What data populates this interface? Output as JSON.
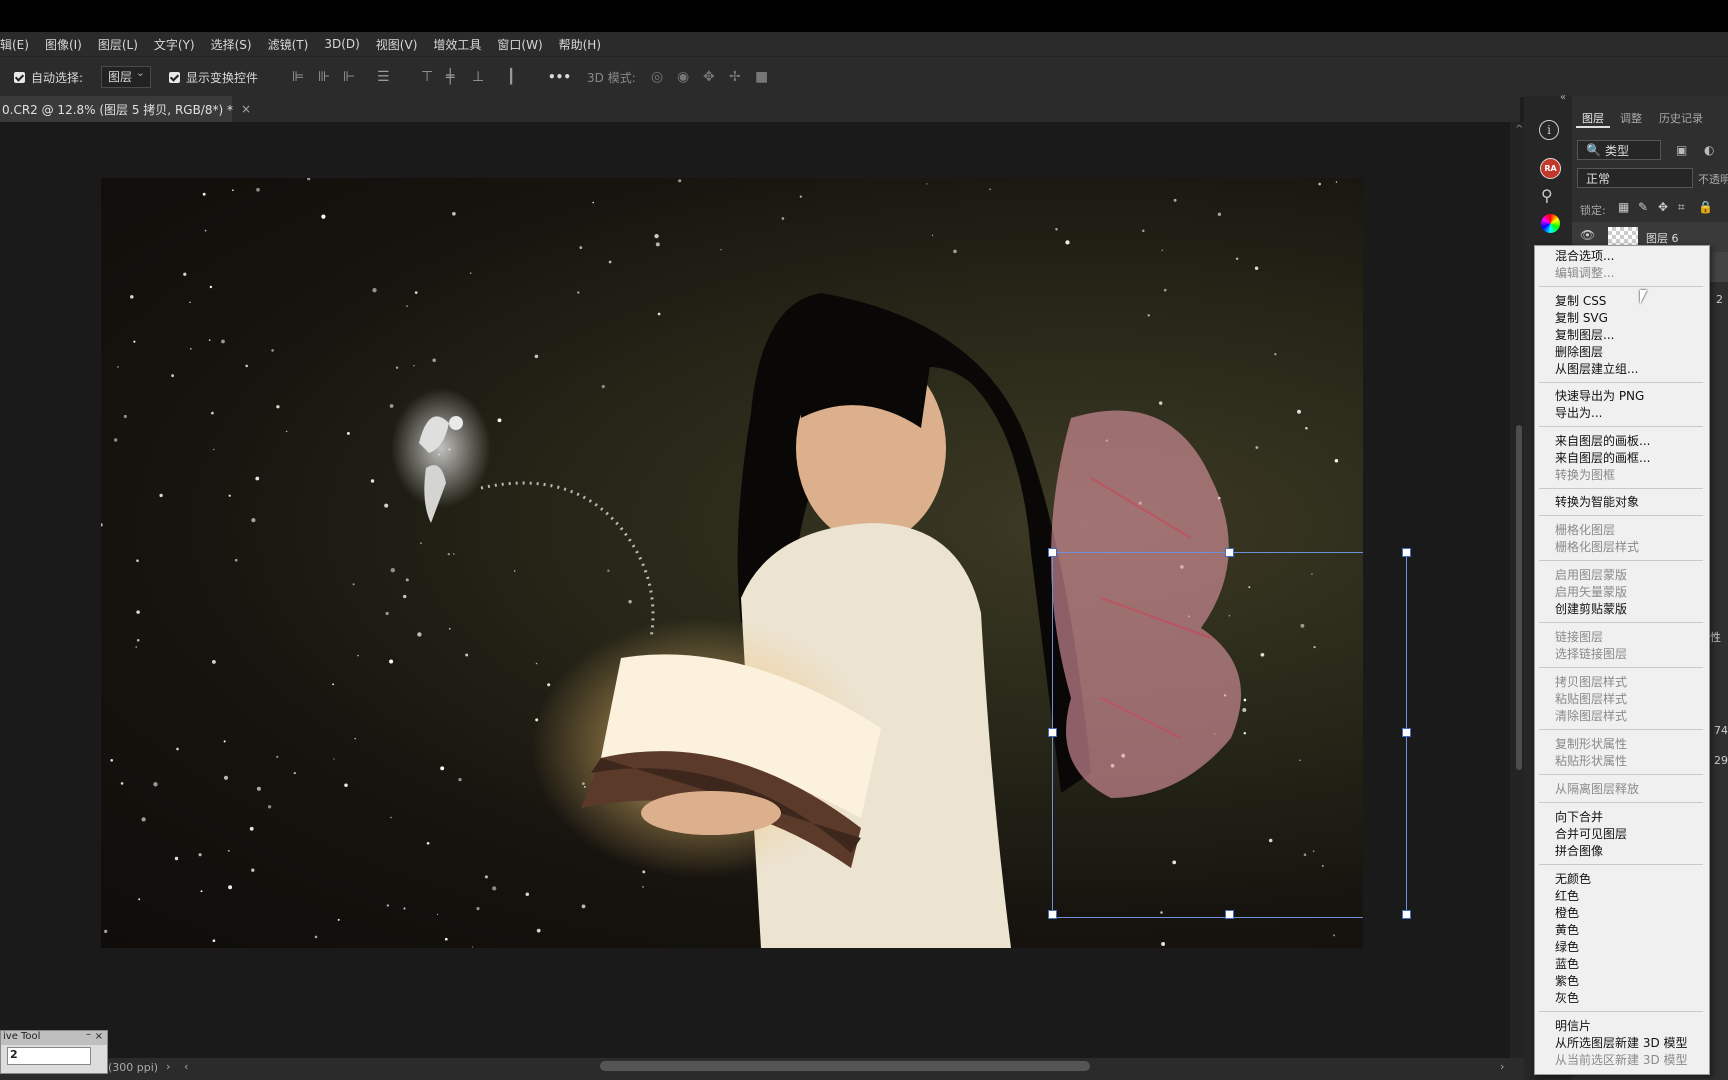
{
  "menubar": {
    "items": [
      "辑(E)",
      "图像(I)",
      "图层(L)",
      "文字(Y)",
      "选择(S)",
      "滤镜(T)",
      "3D(D)",
      "视图(V)",
      "增效工具",
      "窗口(W)",
      "帮助(H)"
    ]
  },
  "options": {
    "auto_select_label": "自动选择:",
    "auto_select_value": "图层",
    "show_transform_label": "显示变换控件",
    "more": "•••",
    "mode_3d_label": "3D 模式:"
  },
  "document": {
    "tab_title": "0.CR2 @ 12.8% (图层 5 拷贝, RGB/8*) *",
    "close": "×"
  },
  "status": {
    "info": "(300 ppi)"
  },
  "tool_panel": {
    "title": "ive Tool",
    "value": "2"
  },
  "layers_panel": {
    "tabs": [
      "图层",
      "调整",
      "历史记录"
    ],
    "filter_value": "类型",
    "blend_mode": "正常",
    "opacity_label": "不透明",
    "lock_label": "锁定:",
    "layer_name": "图层 6",
    "side_values": [
      "2",
      "性",
      "74",
      "29"
    ]
  },
  "context_menu": {
    "groups": [
      [
        {
          "label": "混合选项...",
          "enabled": true
        },
        {
          "label": "编辑调整...",
          "enabled": false
        }
      ],
      [
        {
          "label": "复制 CSS",
          "enabled": true
        },
        {
          "label": "复制 SVG",
          "enabled": true
        },
        {
          "label": "复制图层...",
          "enabled": true
        },
        {
          "label": "删除图层",
          "enabled": true
        },
        {
          "label": "从图层建立组...",
          "enabled": true
        }
      ],
      [
        {
          "label": "快速导出为 PNG",
          "enabled": true
        },
        {
          "label": "导出为...",
          "enabled": true
        }
      ],
      [
        {
          "label": "来自图层的画板...",
          "enabled": true
        },
        {
          "label": "来自图层的画框...",
          "enabled": true
        },
        {
          "label": "转换为图框",
          "enabled": false
        }
      ],
      [
        {
          "label": "转换为智能对象",
          "enabled": true
        }
      ],
      [
        {
          "label": "栅格化图层",
          "enabled": false
        },
        {
          "label": "栅格化图层样式",
          "enabled": false
        }
      ],
      [
        {
          "label": "启用图层蒙版",
          "enabled": false
        },
        {
          "label": "启用矢量蒙版",
          "enabled": false
        },
        {
          "label": "创建剪贴蒙版",
          "enabled": true
        }
      ],
      [
        {
          "label": "链接图层",
          "enabled": false
        },
        {
          "label": "选择链接图层",
          "enabled": false
        }
      ],
      [
        {
          "label": "拷贝图层样式",
          "enabled": false
        },
        {
          "label": "粘贴图层样式",
          "enabled": false
        },
        {
          "label": "清除图层样式",
          "enabled": false
        }
      ],
      [
        {
          "label": "复制形状属性",
          "enabled": false
        },
        {
          "label": "粘贴形状属性",
          "enabled": false
        }
      ],
      [
        {
          "label": "从隔离图层释放",
          "enabled": false
        }
      ],
      [
        {
          "label": "向下合并",
          "enabled": true
        },
        {
          "label": "合并可见图层",
          "enabled": true
        },
        {
          "label": "拼合图像",
          "enabled": true
        }
      ],
      [
        {
          "label": "无颜色",
          "enabled": true
        },
        {
          "label": "红色",
          "enabled": true
        },
        {
          "label": "橙色",
          "enabled": true
        },
        {
          "label": "黄色",
          "enabled": true
        },
        {
          "label": "绿色",
          "enabled": true
        },
        {
          "label": "蓝色",
          "enabled": true
        },
        {
          "label": "紫色",
          "enabled": true
        },
        {
          "label": "灰色",
          "enabled": true
        }
      ],
      [
        {
          "label": "明信片",
          "enabled": true
        },
        {
          "label": "从所选图层新建 3D 模型",
          "enabled": true
        },
        {
          "label": "从当前选区新建 3D 模型",
          "enabled": false
        }
      ]
    ]
  },
  "colors": {
    "accent_selection": "#6f8fd6",
    "menu_bg": "#f0f0f0",
    "ui_bg": "#2b2b2b"
  }
}
